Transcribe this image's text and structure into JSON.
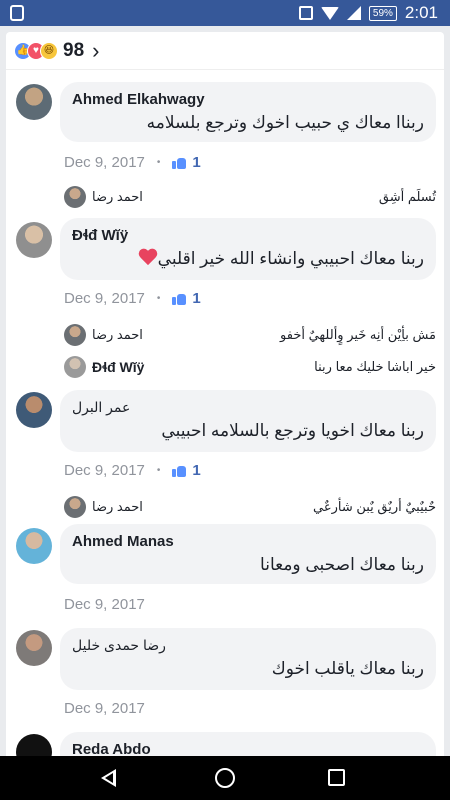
{
  "status_bar": {
    "battery": "59%",
    "time": "2:01"
  },
  "reactions": {
    "count": "98",
    "icons": [
      "like-icon",
      "love-icon",
      "haha-icon"
    ]
  },
  "comments": [
    {
      "author": "Ahmed Elkahwagy",
      "text": "ربناا معاك ي حبيب اخوك وترجع بلسلامه",
      "date": "Dec 9, 2017",
      "likes": "1",
      "replies": [
        {
          "name": "احمد رضا",
          "text": "تُسلَم أشِق"
        }
      ]
    },
    {
      "author": "Ɖɬđ Wĭÿ",
      "text": "ربنا معاك احبيبي وانشاء الله خير اقلبي",
      "date": "Dec 9, 2017",
      "likes": "1",
      "replies": [
        {
          "name": "احمد رضا",
          "text": "مَش بأِيْن أنِه خَير وٍأللهيٌ أخفو"
        },
        {
          "name": "Ɖɬđ Wĭÿ",
          "text": "خير اباشا خليك معا ربنا"
        }
      ]
    },
    {
      "author": "عمر البرل",
      "text": "ربنا معاك اخويا وترجع بالسلامه احبيبي",
      "date": "Dec 9, 2017",
      "likes": "1",
      "replies": [
        {
          "name": "احمد رضا",
          "text": "حٌبيٌبيٌ أريٌق يٌبن شأرعٌي"
        }
      ]
    },
    {
      "author": "Ahmed Manas",
      "text": "ربنا معاك اصحبى ومعانا",
      "date": "Dec 9, 2017"
    },
    {
      "author": "رضا حمدى خليل",
      "text": "ربنا معاك ياقلب اخوك",
      "date": "Dec 9, 2017"
    },
    {
      "author": "Reda Abdo"
    }
  ]
}
